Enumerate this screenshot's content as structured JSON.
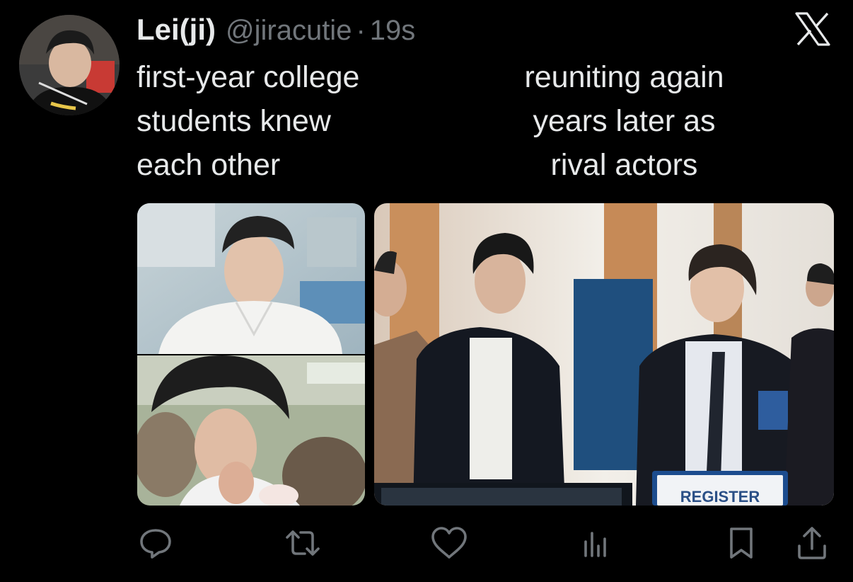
{
  "tweet": {
    "author_name": "Lei(ji)",
    "handle": "@jiracutie",
    "separator": "·",
    "time": "19s",
    "caption_left": [
      "first-year college",
      "students knew",
      "each other"
    ],
    "caption_right": [
      "reuniting again",
      "years later as",
      "rival actors"
    ],
    "photo_sign_text": "REGISTER"
  },
  "icons": {
    "platform_logo": "x-logo-icon",
    "reply": "reply-icon",
    "retweet": "retweet-icon",
    "like": "heart-icon",
    "views": "views-icon",
    "bookmark": "bookmark-icon",
    "share": "share-icon"
  },
  "colors": {
    "background": "#000000",
    "text_primary": "#e7e9ea",
    "text_secondary": "#71767b"
  }
}
